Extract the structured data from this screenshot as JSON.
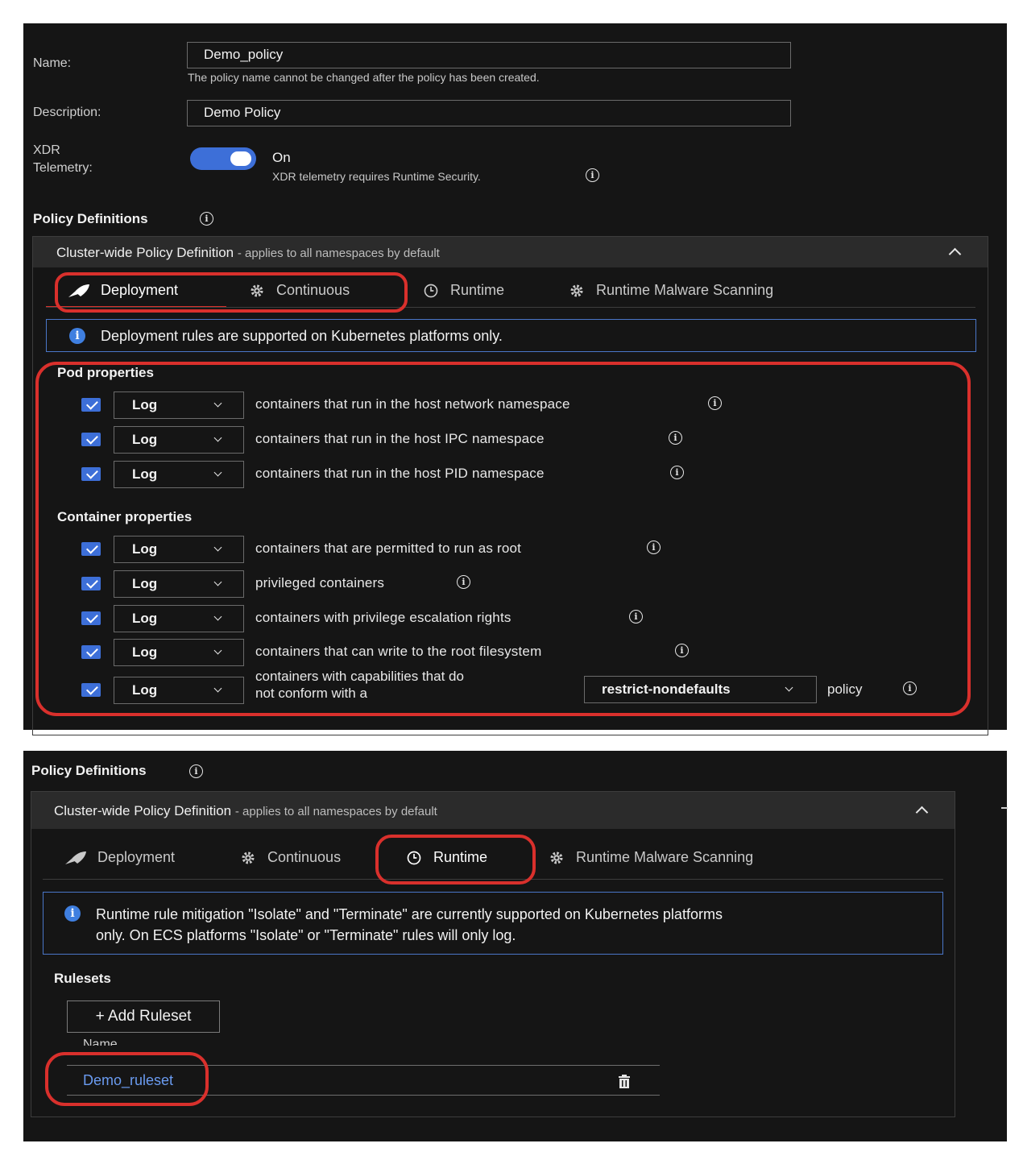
{
  "panel1": {
    "name_label": "Name:",
    "name_value": "Demo_policy",
    "name_hint": "The policy name cannot be changed after the policy has been created.",
    "desc_label": "Description:",
    "desc_value": "Demo Policy",
    "xdr_label": "XDR Telemetry:",
    "xdr_state": "On",
    "xdr_hint": "XDR telemetry requires Runtime Security.",
    "policy_defs_title": "Policy Definitions",
    "card_title": "Cluster-wide Policy Definition",
    "card_sub": "- applies to all namespaces by default",
    "tabs": [
      "Deployment",
      "Continuous",
      "Runtime",
      "Runtime Malware Scanning"
    ],
    "active_tab": "Deployment",
    "callout": "Deployment rules are supported on Kubernetes platforms only.",
    "pod_title": "Pod properties",
    "pod_rules": [
      {
        "action": "Log",
        "text": "containers that run in the host network namespace"
      },
      {
        "action": "Log",
        "text": "containers that run in the host IPC namespace"
      },
      {
        "action": "Log",
        "text": "containers that run in the host PID namespace"
      }
    ],
    "container_title": "Container properties",
    "container_rules": [
      {
        "action": "Log",
        "text": "containers that are permitted to run as root"
      },
      {
        "action": "Log",
        "text": "privileged containers"
      },
      {
        "action": "Log",
        "text": "containers with privilege escalation rights"
      },
      {
        "action": "Log",
        "text": "containers that can write to the root filesystem"
      }
    ],
    "cap_rule": {
      "action": "Log",
      "text_line1": "containers with capabilities that do",
      "text_line2": "not conform with a",
      "policy_select": "restrict-nondefaults",
      "suffix": "policy"
    }
  },
  "panel2": {
    "policy_defs_title": "Policy Definitions",
    "card_title": "Cluster-wide Policy Definition",
    "card_sub": "- applies to all namespaces by default",
    "tabs": [
      "Deployment",
      "Continuous",
      "Runtime",
      "Runtime Malware Scanning"
    ],
    "active_tab": "Runtime",
    "callout_line1": "Runtime rule mitigation \"Isolate\" and \"Terminate\" are currently supported on Kubernetes platforms",
    "callout_line2": "only. On ECS platforms \"Isolate\" or \"Terminate\" rules will only log.",
    "rulesets_title": "Rulesets",
    "add_button": "+ Add Ruleset",
    "name_col": "Name",
    "ruleset_name": "Demo_ruleset"
  },
  "colors": {
    "background": "#151515",
    "accent": "#3d6fd8",
    "link": "#6a9bf0",
    "highlight_ring": "#d9302c",
    "callout_border": "#4a76c8"
  },
  "icons": [
    "info-icon",
    "rocket-icon",
    "gear-icon",
    "clock-icon",
    "chevron-up-icon",
    "chevron-down-icon",
    "trash-icon",
    "checkbox-checked-icon"
  ]
}
